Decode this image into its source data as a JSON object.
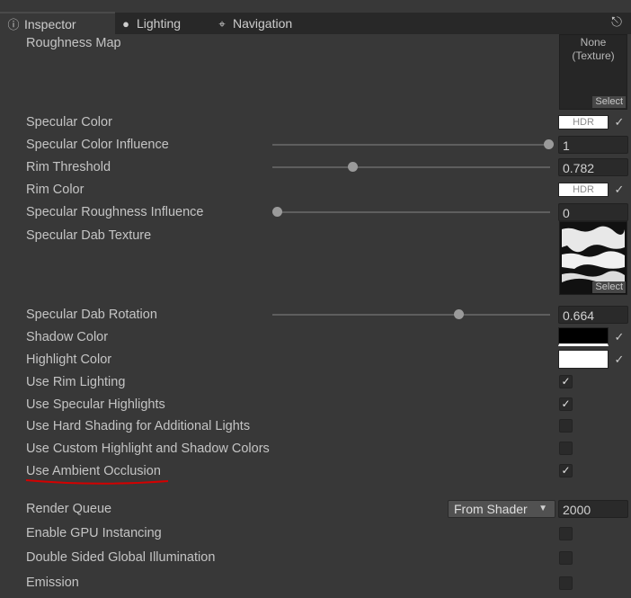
{
  "tabs": [
    {
      "label": "Inspector",
      "icon": "info-icon"
    },
    {
      "label": "Lighting",
      "icon": "bulb-icon"
    },
    {
      "label": "Navigation",
      "icon": "navigation-icon"
    }
  ],
  "properties": {
    "roughness_map": {
      "label": "Roughness Map",
      "texture_none": "None",
      "texture_type": "(Texture)",
      "select": "Select"
    },
    "specular_color": {
      "label": "Specular Color",
      "hdr": "HDR",
      "color": "#ffffff"
    },
    "specular_color_influence": {
      "label": "Specular Color Influence",
      "value": "1",
      "fraction": 1.0
    },
    "rim_threshold": {
      "label": "Rim Threshold",
      "value": "0.782",
      "fraction": 0.28
    },
    "rim_color": {
      "label": "Rim Color",
      "hdr": "HDR",
      "color": "#ffffff"
    },
    "specular_roughness_influence": {
      "label": "Specular Roughness Influence",
      "value": "0",
      "fraction": 0.0
    },
    "specular_dab_texture": {
      "label": "Specular Dab Texture",
      "select": "Select"
    },
    "specular_dab_rotation": {
      "label": "Specular Dab Rotation",
      "value": "0.664",
      "fraction": 0.664
    },
    "shadow_color": {
      "label": "Shadow Color",
      "color": "#000000"
    },
    "highlight_color": {
      "label": "Highlight Color",
      "color": "#ffffff"
    },
    "use_rim_lighting": {
      "label": "Use Rim Lighting",
      "checked": true
    },
    "use_specular_highlights": {
      "label": "Use Specular Highlights",
      "checked": true
    },
    "use_hard_shading": {
      "label": "Use Hard Shading for Additional Lights",
      "checked": false
    },
    "use_custom_colors": {
      "label": "Use Custom Highlight and Shadow Colors",
      "checked": false
    },
    "use_ambient_occlusion": {
      "label": "Use Ambient Occlusion",
      "checked": true
    },
    "render_queue": {
      "label": "Render Queue",
      "option": "From Shader",
      "value": "2000"
    },
    "enable_gpu_instancing": {
      "label": "Enable GPU Instancing",
      "checked": false
    },
    "double_sided_gi": {
      "label": "Double Sided Global Illumination",
      "checked": false
    },
    "emission": {
      "label": "Emission",
      "checked": false
    }
  },
  "annotation_color": "#d40000"
}
